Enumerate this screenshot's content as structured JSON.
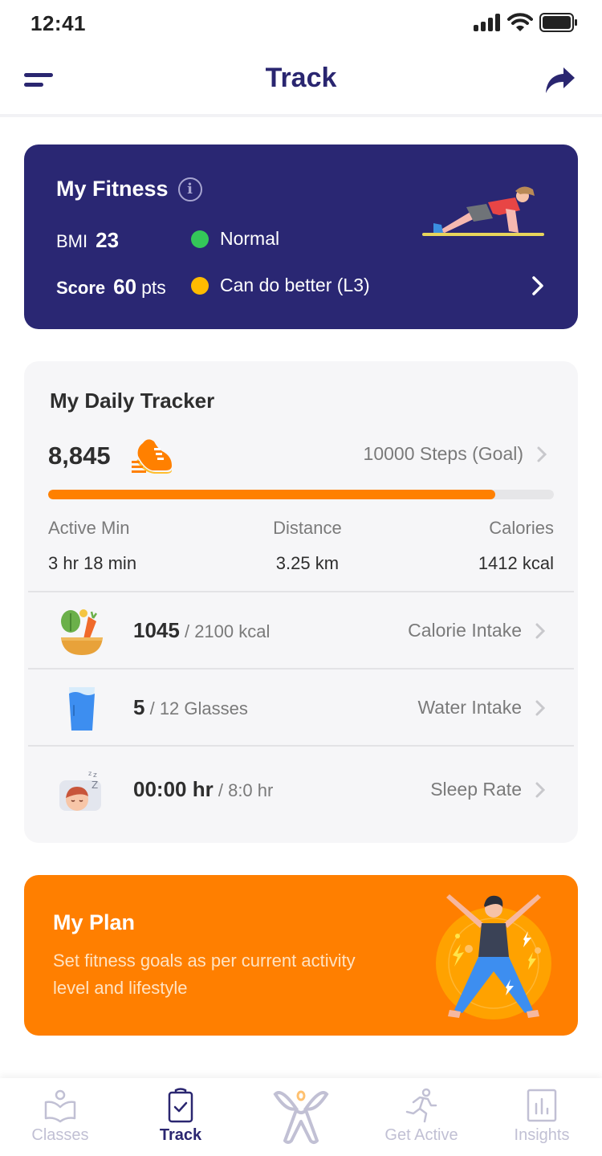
{
  "status_bar": {
    "time": "12:41",
    "icons": [
      "signal-icon",
      "wifi-icon",
      "battery-icon"
    ]
  },
  "header": {
    "title": "Track",
    "left_icon": "menu-icon",
    "right_icon": "share-icon"
  },
  "fitness": {
    "title": "My Fitness",
    "info_icon": "info-icon",
    "bmi_label": "BMI",
    "bmi_value": "23",
    "bmi_status": "Normal",
    "bmi_status_color": "#34c759",
    "score_label": "Score",
    "score_value": "60",
    "score_unit": "pts",
    "score_status": "Can do better (L3)",
    "score_status_color": "#ffbb00",
    "illustration": "plank-exercise-illustration",
    "background": "#2a2773"
  },
  "tracker": {
    "title": "My Daily Tracker",
    "steps": "8,845",
    "steps_icon": "running-shoe-icon",
    "goal_label": "10000 Steps (Goal)",
    "progress_percent": 88.45,
    "metrics": [
      {
        "label": "Active Min",
        "value": "3 hr 18 min"
      },
      {
        "label": "Distance",
        "value": "3.25 km"
      },
      {
        "label": "Calories",
        "value": "1412 kcal"
      }
    ],
    "rows": [
      {
        "icon": "salad-bowl-icon",
        "value": "1045",
        "total": "/ 2100 kcal",
        "label": "Calorie Intake"
      },
      {
        "icon": "water-glass-icon",
        "value": "5",
        "total": "/ 12 Glasses",
        "label": "Water Intake"
      },
      {
        "icon": "sleeping-face-icon",
        "value": "00:00 hr",
        "total": "/ 8:0 hr",
        "label": "Sleep Rate"
      }
    ]
  },
  "plan": {
    "title": "My Plan",
    "description": "Set fitness goals as per current activity level and lifestyle",
    "illustration": "jumping-jack-illustration",
    "background": "#ff7f00"
  },
  "tabs": [
    {
      "label": "Classes",
      "icon": "reader-book-icon",
      "active": false
    },
    {
      "label": "Track",
      "icon": "clipboard-check-icon",
      "active": true
    },
    {
      "label": "",
      "icon": "app-logo-icon",
      "active": false
    },
    {
      "label": "Get Active",
      "icon": "running-person-icon",
      "active": false
    },
    {
      "label": "Insights",
      "icon": "bar-chart-icon",
      "active": false
    }
  ]
}
